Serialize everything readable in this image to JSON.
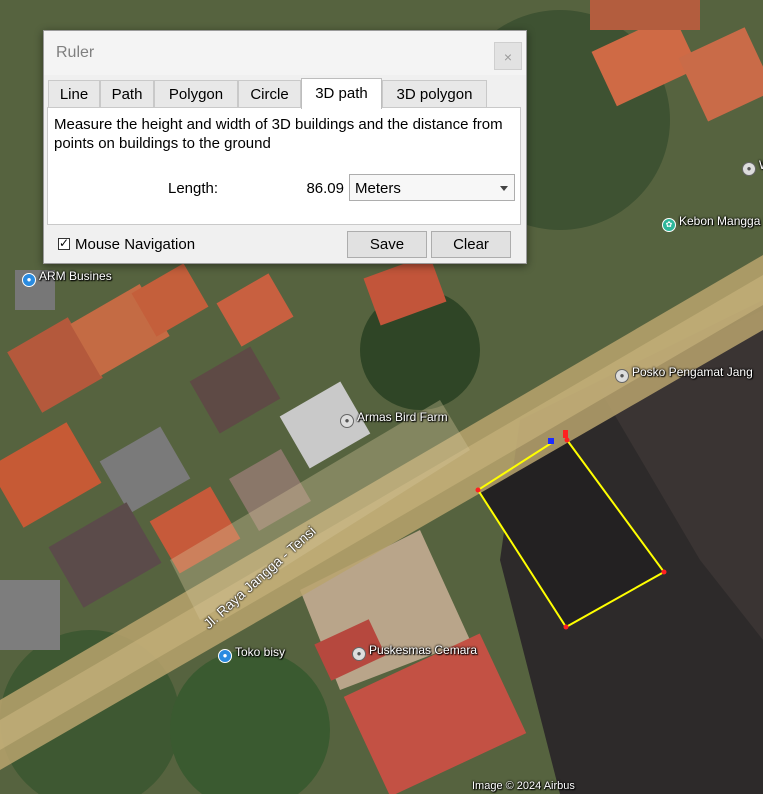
{
  "map": {
    "places": {
      "arm": "ARM Busines",
      "kebon": "Kebon Mangga I",
      "posko": "Posko Pengamat Jang",
      "armas": "Armas Bird Farm",
      "toko": "Toko bisy",
      "puskesmas": "Puskesmas Cemara",
      "edge_w": "W"
    },
    "road_label": "Jl. Raya Jangga - Tensi",
    "attribution": "Image © 2024 Airbus",
    "colors": {
      "path": "#ffff00",
      "vertex": "#ff2020"
    }
  },
  "ruler": {
    "title": "Ruler",
    "close_glyph": "×",
    "tabs": [
      "Line",
      "Path",
      "Polygon",
      "Circle",
      "3D path",
      "3D polygon"
    ],
    "active_tab": "3D path",
    "description": "Measure the height and width of 3D buildings and the distance from points on buildings to the ground",
    "length_label": "Length:",
    "length_value": "86.09",
    "unit": "Meters",
    "mouse_navigation_label": "Mouse Navigation",
    "mouse_navigation_checked": true,
    "save_label": "Save",
    "clear_label": "Clear"
  }
}
